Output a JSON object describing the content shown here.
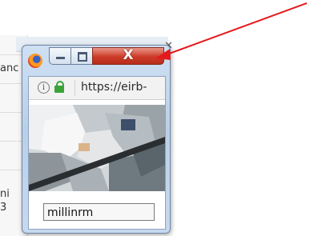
{
  "background_window": {
    "fragments": [
      "anc",
      "ni",
      "3"
    ]
  },
  "popup": {
    "browser_icon": "firefox-logo",
    "titlebar": {
      "min_icon": "minimize-icon",
      "max_icon": "maximize-icon",
      "close_label": "X"
    },
    "address_bar": {
      "url": "https://eirb-",
      "info_glyph": "i",
      "secure": true
    },
    "user_label": "millinrm"
  },
  "annotation": {
    "arrow_color": "#e5191c",
    "close_button_color": "#c8391f"
  }
}
